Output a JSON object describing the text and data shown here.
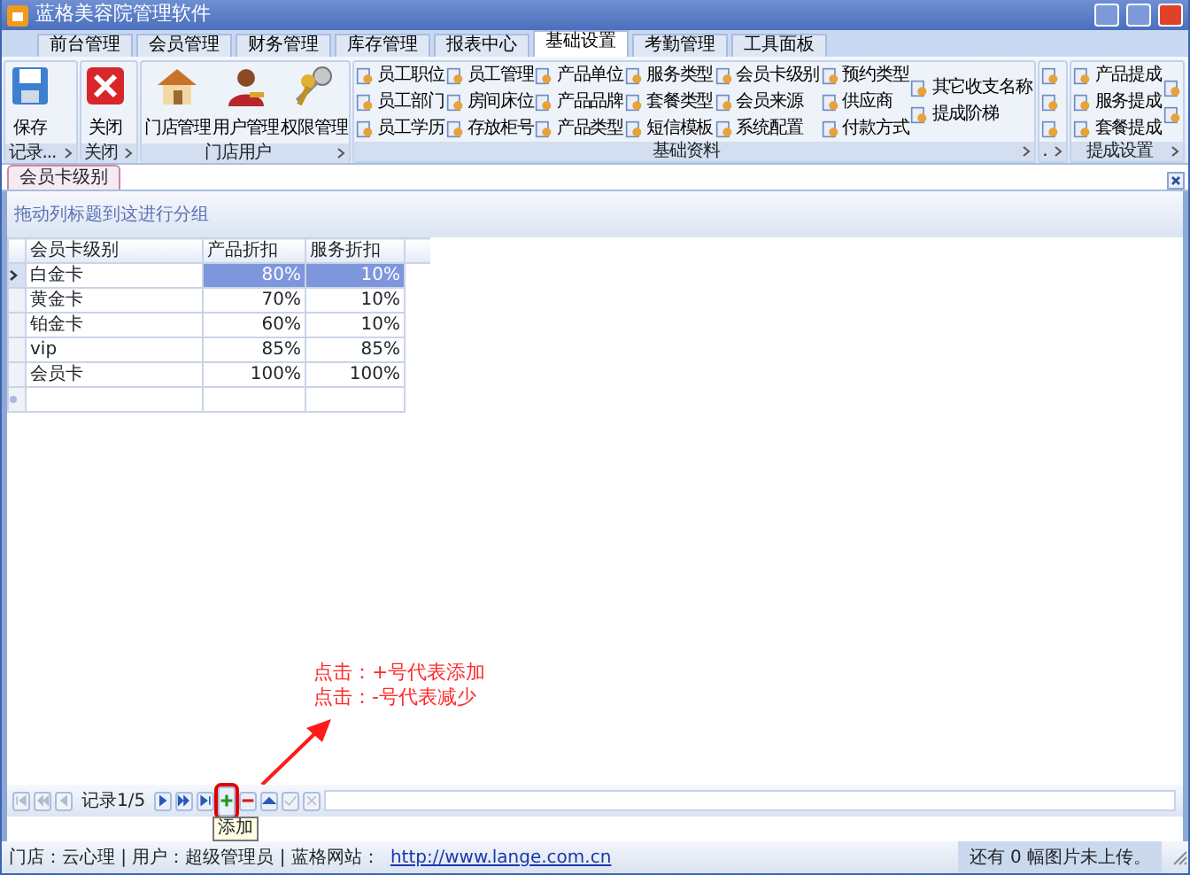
{
  "window": {
    "title": "蓝格美容院管理软件"
  },
  "menu_tabs": [
    {
      "label": "前台管理",
      "selected": false
    },
    {
      "label": "会员管理",
      "selected": false
    },
    {
      "label": "财务管理",
      "selected": false
    },
    {
      "label": "库存管理",
      "selected": false
    },
    {
      "label": "报表中心",
      "selected": false
    },
    {
      "label": "基础设置",
      "selected": true
    },
    {
      "label": "考勤管理",
      "selected": false
    },
    {
      "label": "工具面板",
      "selected": false
    }
  ],
  "ribbon_groups": [
    {
      "caption": "记录...",
      "columns": [
        [
          {
            "kind": "save",
            "label": "保存"
          }
        ]
      ]
    },
    {
      "caption": "关闭",
      "columns": [
        [
          {
            "kind": "close",
            "label": "关闭"
          }
        ]
      ]
    },
    {
      "caption": "门店用户",
      "columns": [
        [
          {
            "kind": "store",
            "label": "门店管理"
          }
        ],
        [
          {
            "kind": "user",
            "label": "用户管理"
          }
        ],
        [
          {
            "kind": "keys",
            "label": "权限管理"
          }
        ]
      ]
    },
    {
      "caption": "基础资料",
      "columns": [
        [
          {
            "kind": "small",
            "label": "员工职位"
          },
          {
            "kind": "small",
            "label": "员工部门"
          },
          {
            "kind": "small",
            "label": "员工学历"
          }
        ],
        [
          {
            "kind": "small",
            "label": "员工管理"
          },
          {
            "kind": "small",
            "label": "房间床位"
          },
          {
            "kind": "small",
            "label": "存放柜号"
          }
        ],
        [
          {
            "kind": "small",
            "label": "产品单位"
          },
          {
            "kind": "small",
            "label": "产品品牌"
          },
          {
            "kind": "small",
            "label": "产品类型"
          }
        ],
        [
          {
            "kind": "small",
            "label": "服务类型"
          },
          {
            "kind": "small",
            "label": "套餐类型"
          },
          {
            "kind": "small",
            "label": "短信模板"
          }
        ],
        [
          {
            "kind": "small",
            "label": "会员卡级别"
          },
          {
            "kind": "small",
            "label": "会员来源"
          },
          {
            "kind": "small",
            "label": "系统配置"
          }
        ],
        [
          {
            "kind": "small",
            "label": "预约类型"
          },
          {
            "kind": "small",
            "label": "供应商"
          },
          {
            "kind": "small",
            "label": "付款方式"
          }
        ],
        [
          {
            "kind": "small",
            "label": "其它收支名称"
          },
          {
            "kind": "small",
            "label": "提成阶梯"
          }
        ]
      ]
    },
    {
      "caption": ".",
      "columns": [
        [
          {
            "kind": "small"
          },
          {
            "kind": "small"
          },
          {
            "kind": "small"
          }
        ]
      ]
    },
    {
      "caption": "提成设置",
      "columns": [
        [
          {
            "kind": "small",
            "label": "产品提成"
          },
          {
            "kind": "small",
            "label": "服务提成"
          },
          {
            "kind": "small",
            "label": "套餐提成"
          }
        ],
        [
          {
            "kind": "small"
          },
          {
            "kind": "small"
          }
        ]
      ]
    }
  ],
  "doc_tabs": [
    {
      "label": "会员卡级别",
      "selected": true
    }
  ],
  "group_panel": {
    "hint": "拖动列标题到这进行分组"
  },
  "grid": {
    "columns": [
      "会员卡级别",
      "产品折扣",
      "服务折扣"
    ],
    "rows": [
      {
        "cells": [
          "白金卡",
          "80%",
          "10%"
        ],
        "selected": true
      },
      {
        "cells": [
          "黄金卡",
          "70%",
          "10%"
        ],
        "selected": false
      },
      {
        "cells": [
          "铂金卡",
          "60%",
          "10%"
        ],
        "selected": false
      },
      {
        "cells": [
          "vip",
          "85%",
          "85%"
        ],
        "selected": false
      },
      {
        "cells": [
          "会员卡",
          "100%",
          "100%"
        ],
        "selected": false
      }
    ]
  },
  "annotation": {
    "lines": [
      "点击：+号代表添加",
      "点击：-号代表减少"
    ]
  },
  "navigator": {
    "items": [
      {
        "kind": "first",
        "disabled": true
      },
      {
        "kind": "prev-page",
        "disabled": true
      },
      {
        "kind": "prev",
        "disabled": true
      },
      {
        "kind": "text",
        "label": "记录1/5"
      },
      {
        "kind": "next",
        "disabled": false
      },
      {
        "kind": "next-page",
        "disabled": false
      },
      {
        "kind": "last",
        "disabled": false
      },
      {
        "kind": "add",
        "disabled": false,
        "highlighted": true,
        "tooltip": "添加"
      },
      {
        "kind": "remove",
        "disabled": false
      },
      {
        "kind": "edit",
        "disabled": false
      },
      {
        "kind": "accept",
        "disabled": true
      },
      {
        "kind": "cancel",
        "disabled": true
      }
    ]
  },
  "status_bar": {
    "left": "门店：云心理 | 用户：超级管理员 | 蓝格网站：",
    "link": "http://www.lange.com.cn",
    "right": "还有 0 幅图片未上传。"
  }
}
